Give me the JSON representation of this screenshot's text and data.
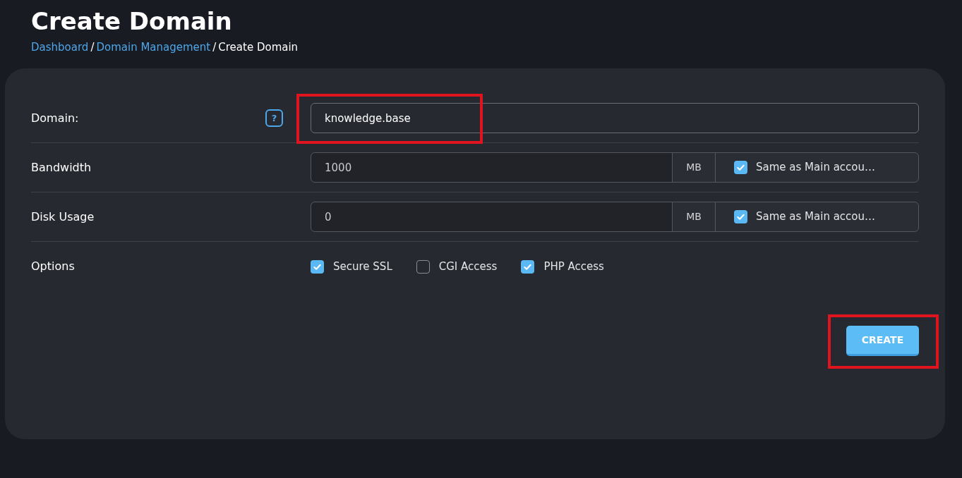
{
  "page_title": "Create Domain",
  "breadcrumb": [
    {
      "label": "Dashboard",
      "link": true
    },
    {
      "label": "Domain Management",
      "link": true
    },
    {
      "label": "Create Domain",
      "link": false
    }
  ],
  "breadcrumb_separator": "/",
  "form": {
    "rows": [
      {
        "kind": "text",
        "label": "Domain:",
        "help": "?",
        "value": "knowledge.base",
        "highlighted": true
      },
      {
        "kind": "quota",
        "label": "Bandwidth",
        "value": "1000",
        "unit": "MB",
        "same_as_main": {
          "label": "Same as Main accou…",
          "checked": true
        }
      },
      {
        "kind": "quota",
        "label": "Disk Usage",
        "value": "0",
        "unit": "MB",
        "same_as_main": {
          "label": "Same as Main accou…",
          "checked": true
        }
      },
      {
        "kind": "options",
        "label": "Options",
        "options": [
          {
            "label": "Secure SSL",
            "checked": true
          },
          {
            "label": "CGI Access",
            "checked": false
          },
          {
            "label": "PHP Access",
            "checked": true
          }
        ]
      }
    ]
  },
  "create_button": {
    "label": "CREATE",
    "highlighted": true
  }
}
